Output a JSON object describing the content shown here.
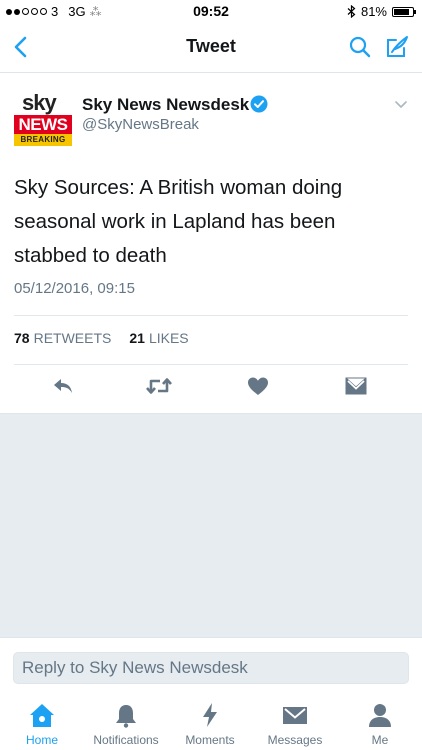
{
  "status_bar": {
    "carrier": "3",
    "network": "3G",
    "time": "09:52",
    "battery": "81%",
    "battery_level": 0.81
  },
  "nav": {
    "title": "Tweet",
    "accent": "#1da1f2"
  },
  "tweet": {
    "avatar": {
      "line1": "sky",
      "line2": "NEWS",
      "line3": "BREAKING"
    },
    "author_name": "Sky News Newsdesk",
    "handle": "@SkyNewsBreak",
    "text": "Sky Sources: A British woman doing seasonal work in Lapland has been stabbed to death",
    "timestamp": "05/12/2016, 09:15",
    "retweet_count": "78",
    "retweet_label": "RETWEETS",
    "like_count": "21",
    "like_label": "LIKES",
    "actions": [
      "reply-icon",
      "retweet-icon",
      "heart-icon",
      "dm-envelope-icon"
    ]
  },
  "reply": {
    "placeholder": "Reply to Sky News Newsdesk"
  },
  "tabs": [
    {
      "label": "Home",
      "icon": "home-icon",
      "active": true
    },
    {
      "label": "Notifications",
      "icon": "bell-icon",
      "active": false
    },
    {
      "label": "Moments",
      "icon": "lightning-icon",
      "active": false
    },
    {
      "label": "Messages",
      "icon": "envelope-icon",
      "active": false
    },
    {
      "label": "Me",
      "icon": "person-icon",
      "active": false
    }
  ],
  "colors": {
    "accent": "#1da1f2",
    "muted": "#657786",
    "background": "#e6ecf0"
  }
}
